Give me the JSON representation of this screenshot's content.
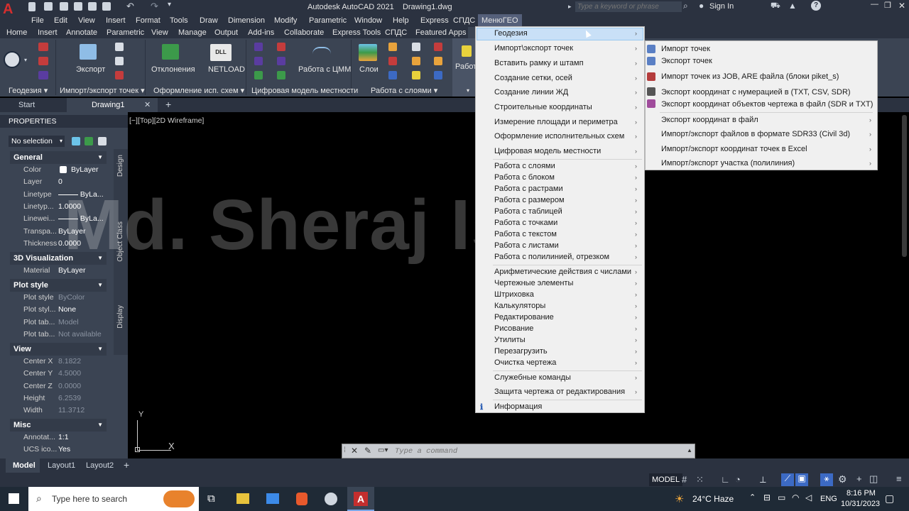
{
  "title": {
    "app": "Autodesk AutoCAD 2021",
    "file": "Drawing1.dwg",
    "search_placeholder": "Type a keyword or phrase",
    "sign_in": "Sign In"
  },
  "menubar": [
    "File",
    "Edit",
    "View",
    "Insert",
    "Format",
    "Tools",
    "Draw",
    "Dimension",
    "Modify",
    "Parametric",
    "Window",
    "Help",
    "Express",
    "СПДС",
    "МенюГЕО"
  ],
  "ribbon_tabs": [
    "Home",
    "Insert",
    "Annotate",
    "Parametric",
    "View",
    "Manage",
    "Output",
    "Add-ins",
    "Collaborate",
    "Express Tools",
    "СПДС",
    "Featured Apps"
  ],
  "ribbon": {
    "buttons": [
      "Экспорт",
      "Отклонения",
      "NETLOAD",
      "Работа с ЦММ",
      "Слои",
      "Работ"
    ],
    "netload_badge": "DLL",
    "panels": [
      "Геодезия",
      "Импорт/экспорт точек",
      "Оформление исп. схем",
      "Цифровая модель местности",
      "Работа с слоями"
    ]
  },
  "doc_tabs": [
    "Start",
    "Drawing1"
  ],
  "properties": {
    "title": "PROPERTIES",
    "selection": "No selection",
    "side_tabs": [
      "Design",
      "Object Class",
      "Display"
    ],
    "sections": [
      {
        "name": "General",
        "rows": [
          [
            "Color",
            "ByLayer"
          ],
          [
            "Layer",
            "0"
          ],
          [
            "Linetype",
            "ByLa..."
          ],
          [
            "Linetyp...",
            "1.0000"
          ],
          [
            "Linewei...",
            "ByLa..."
          ],
          [
            "Transpa...",
            "ByLayer"
          ],
          [
            "Thickness",
            "0.0000"
          ]
        ]
      },
      {
        "name": "3D Visualization",
        "rows": [
          [
            "Material",
            "ByLayer"
          ]
        ]
      },
      {
        "name": "Plot style",
        "rows": [
          [
            "Plot style",
            "ByColor"
          ],
          [
            "Plot styl...",
            "None"
          ],
          [
            "Plot tab...",
            "Model"
          ],
          [
            "Plot tab...",
            "Not available"
          ]
        ]
      },
      {
        "name": "View",
        "rows": [
          [
            "Center X",
            "8.1822"
          ],
          [
            "Center Y",
            "4.5000"
          ],
          [
            "Center Z",
            "0.0000"
          ],
          [
            "Height",
            "6.2539"
          ],
          [
            "Width",
            "11.3712"
          ]
        ]
      },
      {
        "name": "Misc",
        "rows": [
          [
            "Annotat...",
            "1:1"
          ],
          [
            "UCS ico...",
            "Yes"
          ]
        ]
      }
    ]
  },
  "viewport_label": "[−][Top][2D Wireframe]",
  "watermark": "Md. Sheraj Islam",
  "ucs": {
    "y": "Y",
    "x": "X"
  },
  "menu_geo": [
    "Геодезия",
    "Импорт\\экспорт точек",
    "Вставить рамку и штамп",
    "Создание сетки, осей",
    "Создание линии ЖД",
    "Строительные координаты",
    "Измерение площади и периметра",
    "Оформление исполнительных схем",
    "Цифровая модель местности",
    "Работа с слоями",
    "Работа с блоком",
    "Работа с растрами",
    "Работа с размером",
    "Работа с таблицей",
    "Работа с точками",
    "Работа с текстом",
    "Работа с листами",
    "Работа с полилинией, отрезком",
    "Арифметические действия с числами",
    "Чертежные элементы",
    "Штриховка",
    "Калькуляторы",
    "Редактирование",
    "Рисование",
    "Утилиты",
    "Перезагрузить",
    "Очистка чертежа",
    "Служебные команды",
    "Защита чертежа от редактирования",
    "Информация"
  ],
  "submenu_geodesy": [
    "Импорт точек",
    "Экспорт точек",
    "Импорт точек из JOB, ARE файла (блоки piket_s)",
    "Экспорт координат с нумерацией в (TXT, CSV, SDR)",
    "Экспорт координат объектов чертежа в файл (SDR и TXT)",
    "Экспорт координат в файл",
    "Импорт/экспорт файлов в формате SDR33 (Civil 3d)",
    "Импорт/экспорт координат точек в Excel",
    "Импорт/экспорт участка (полилиния)"
  ],
  "command_placeholder": "Type a command",
  "layout_tabs": [
    "Model",
    "Layout1",
    "Layout2"
  ],
  "status_model": "MODEL",
  "taskbar": {
    "search": "Type here to search",
    "weather": "24°C  Haze",
    "lang": "ENG",
    "time": "8:16 PM",
    "date": "10/31/2023"
  }
}
